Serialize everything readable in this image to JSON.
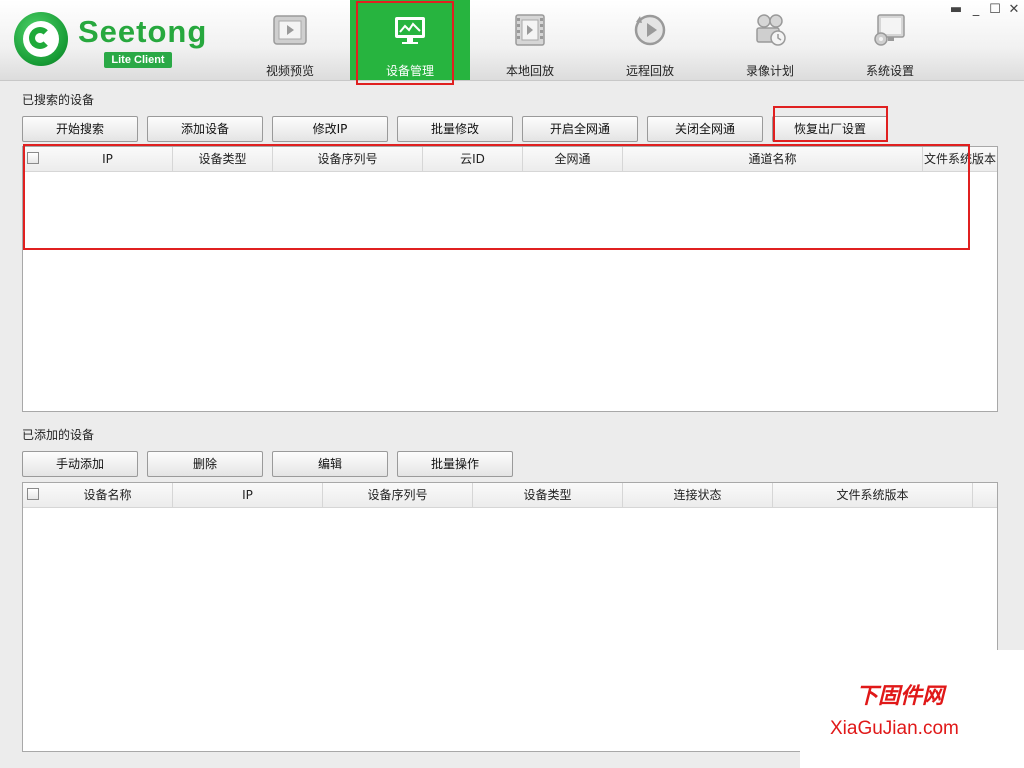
{
  "app": {
    "logo_name": "Seetong",
    "logo_badge": "Lite Client",
    "window_controls": [
      "minimize-icon",
      "maximize-icon",
      "close-icon"
    ]
  },
  "nav": {
    "items": [
      {
        "label": "视频预览",
        "icon": "video-preview-icon"
      },
      {
        "label": "设备管理",
        "icon": "device-management-icon",
        "active": true
      },
      {
        "label": "本地回放",
        "icon": "local-playback-icon"
      },
      {
        "label": "远程回放",
        "icon": "remote-playback-icon"
      },
      {
        "label": "录像计划",
        "icon": "record-schedule-icon"
      },
      {
        "label": "系统设置",
        "icon": "system-settings-icon"
      }
    ],
    "active_color": "#27b43f"
  },
  "searched": {
    "title": "已搜索的设备",
    "buttons": [
      "开始搜索",
      "添加设备",
      "修改IP",
      "批量修改",
      "开启全网通",
      "关闭全网通",
      "恢复出厂设置"
    ],
    "columns": [
      "IP",
      "设备类型",
      "设备序列号",
      "云ID",
      "全网通",
      "通道名称",
      "文件系统版本"
    ],
    "rows": []
  },
  "added": {
    "title": "已添加的设备",
    "buttons": [
      "手动添加",
      "删除",
      "编辑",
      "批量操作"
    ],
    "columns": [
      "设备名称",
      "IP",
      "设备序列号",
      "设备类型",
      "连接状态",
      "文件系统版本"
    ],
    "rows": []
  },
  "watermark": {
    "cn": "下固件网",
    "en": "XiaGuJian.com"
  },
  "colors": {
    "brand_green": "#27a83e",
    "highlight_red": "#e02020"
  }
}
